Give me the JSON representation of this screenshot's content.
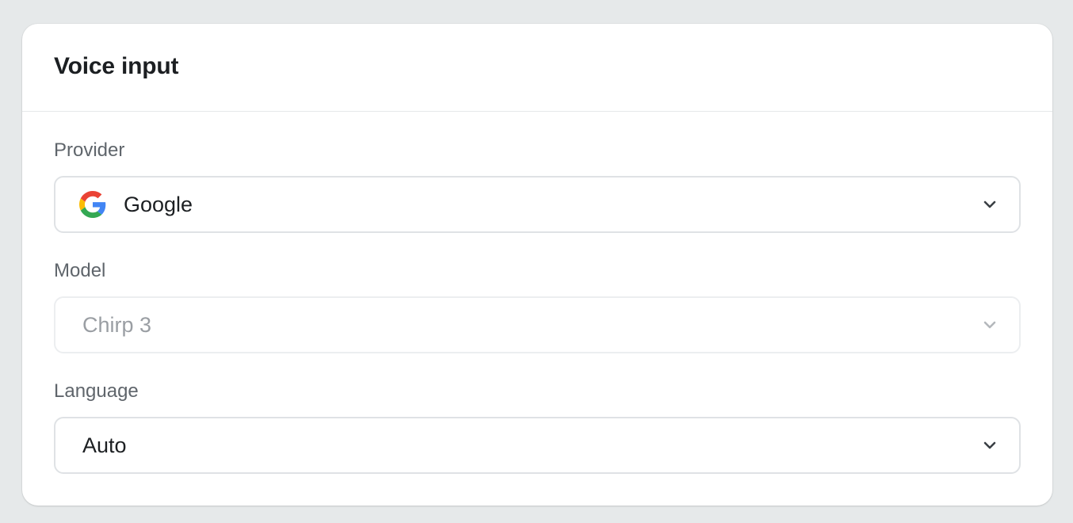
{
  "card": {
    "title": "Voice input"
  },
  "fields": {
    "provider": {
      "label": "Provider",
      "value": "Google",
      "icon": "google-logo-icon"
    },
    "model": {
      "label": "Model",
      "value": "Chirp 3",
      "disabled": true
    },
    "language": {
      "label": "Language",
      "value": "Auto"
    }
  },
  "colors": {
    "page_background": "#e6e9ea",
    "card_background": "#ffffff",
    "text_primary": "#1c1f22",
    "text_label": "#5f656b",
    "text_disabled": "#9a9ea3",
    "google_blue": "#4285F4",
    "google_red": "#EA4335",
    "google_yellow": "#FBBC05",
    "google_green": "#34A853"
  }
}
